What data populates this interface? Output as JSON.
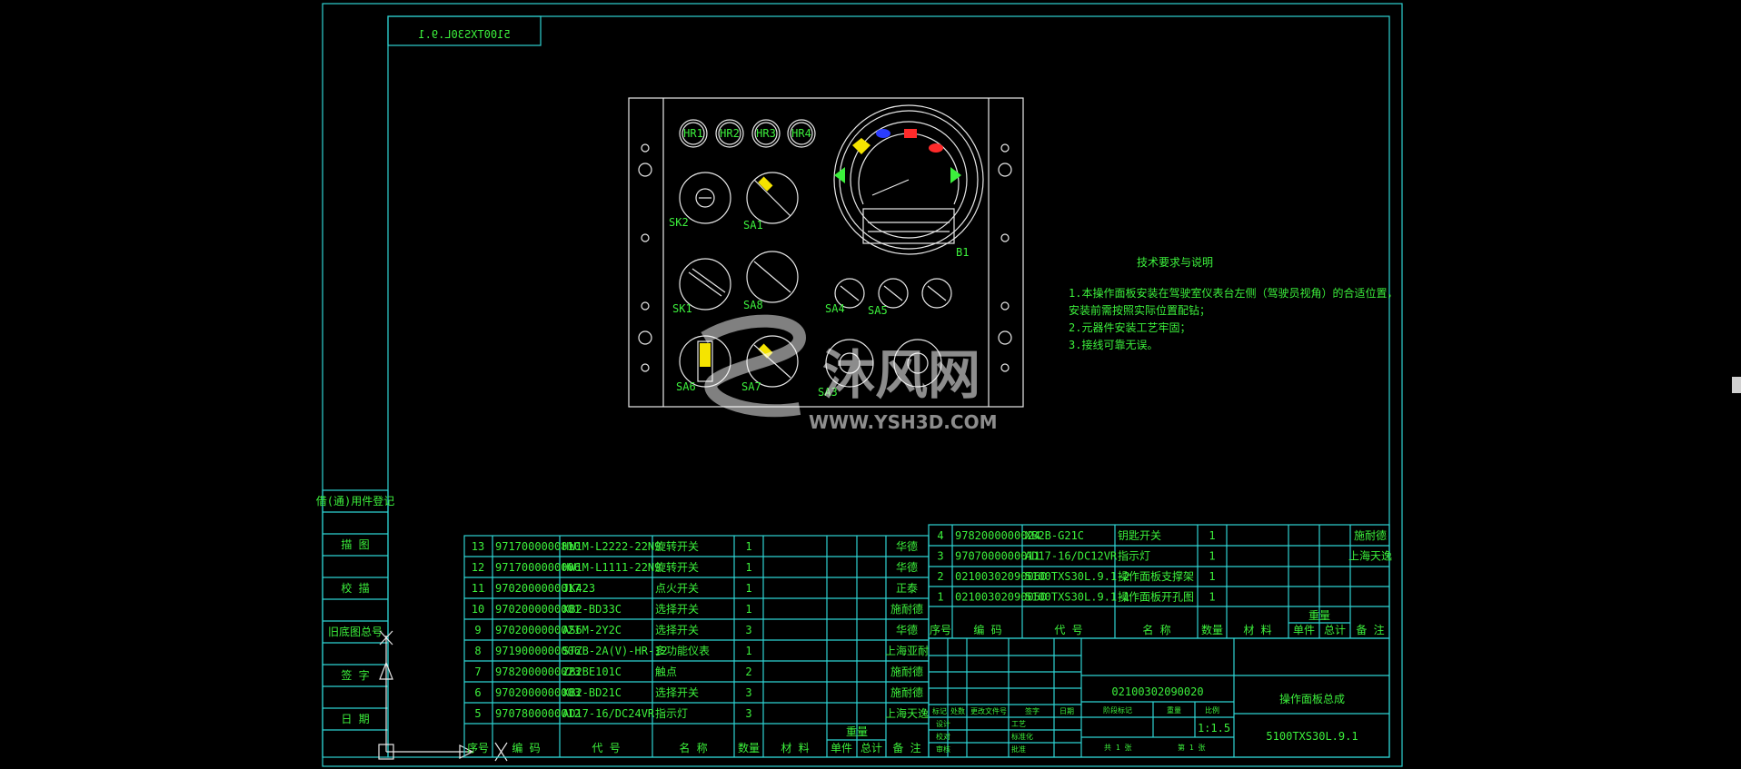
{
  "drawing_code_mirrored": "5100TXS30L.9.1",
  "notes": {
    "title": "技术要求与说明",
    "lines": [
      "1.本操作面板安装在驾驶室仪表台左侧（驾驶员视角）的合适位置，",
      "   安装前需按照实际位置配钻；",
      "2.元器件安装工艺牢固；",
      "3.接线可靠无误。"
    ]
  },
  "panel": {
    "indicators": [
      "HR1",
      "HR2",
      "HR3",
      "HR4"
    ],
    "switches": [
      "SK2",
      "SA1",
      "SK1",
      "SA8",
      "SA4",
      "SA5",
      "B1",
      "SA6",
      "SA7",
      "SA3"
    ]
  },
  "left_stamps": [
    "借(通)用件登记",
    "描 图",
    "校 描",
    "旧底图总号",
    "签 字",
    "日 期"
  ],
  "bom_left": {
    "rows": [
      {
        "no": "13",
        "code": "9717000000810",
        "spec": "HW1M-L2222-22N9",
        "name": "旋转开关",
        "qty": "1",
        "maker": "华德"
      },
      {
        "no": "12",
        "code": "9717000000006",
        "spec": "HW1M-L1111-22N9",
        "name": "旋转开关",
        "qty": "1",
        "maker": "华德"
      },
      {
        "no": "11",
        "code": "9702000000017",
        "spec": "JK423",
        "name": "点火开关",
        "qty": "1",
        "maker": "正泰"
      },
      {
        "no": "10",
        "code": "9702000000001",
        "spec": "XB2-BD33C",
        "name": "选择开关",
        "qty": "1",
        "maker": "施耐德"
      },
      {
        "no": "9",
        "code": "9702000000021",
        "spec": "AS6M-2Y2C",
        "name": "选择开关",
        "qty": "3",
        "maker": "华德"
      },
      {
        "no": "8",
        "code": "9719000000006",
        "spec": "STZB-2A(V)-HR-12",
        "name": "多功能仪表",
        "qty": "1",
        "maker": "上海亚耐"
      },
      {
        "no": "7",
        "code": "9782000000023",
        "spec": "ZB2BE101C",
        "name": "触点",
        "qty": "2",
        "maker": "施耐德"
      },
      {
        "no": "6",
        "code": "9702000000003",
        "spec": "XB2-BD21C",
        "name": "选择开关",
        "qty": "3",
        "maker": "施耐德"
      },
      {
        "no": "5",
        "code": "9707800000012",
        "spec": "AD17-16/DC24VR",
        "name": "指示灯",
        "qty": "3",
        "maker": "上海天逸"
      }
    ],
    "header": [
      "序号",
      "编 码",
      "代 号",
      "名 称",
      "数量",
      "材 料",
      "单件",
      "总计",
      "备 注"
    ],
    "weight_header": "重量"
  },
  "bom_right": {
    "rows": [
      {
        "no": "4",
        "code": "9782000000024",
        "spec": "XB2B-G21C",
        "name": "钥匙开关",
        "qty": "1",
        "maker": "施耐德"
      },
      {
        "no": "3",
        "code": "9707000000011",
        "spec": "AD17-16/DC12VR",
        "name": "指示灯",
        "qty": "1",
        "maker": "上海天逸"
      },
      {
        "no": "2",
        "code": "02100302090060",
        "spec": "5100TXS30L.9.1-2",
        "name": "操作面板支撑架",
        "qty": "1",
        "maker": ""
      },
      {
        "no": "1",
        "code": "02100302090050",
        "spec": "5100TXS30L.9.1-1",
        "name": "操作面板开孔图",
        "qty": "1",
        "maker": ""
      }
    ],
    "header": [
      "序号",
      "编 码",
      "代 号",
      "名 称",
      "数量",
      "材 料",
      "单件",
      "总计",
      "备 注"
    ],
    "weight_header": "重量"
  },
  "title_block": {
    "code": "02100302090020",
    "title": "操作面板总成",
    "drawing_no": "5100TXS30L.9.1",
    "scale": "1:1.5",
    "left_labels": [
      "标记",
      "处数",
      "更改文件号",
      "签字",
      "日期"
    ],
    "role_labels": [
      "设计",
      "校对",
      "审核",
      "工艺",
      "标准化",
      "批准"
    ],
    "stage_labels": [
      "阶段标记",
      "重量",
      "比例"
    ],
    "sheet_labels": [
      "共 1 张",
      "第 1 张"
    ]
  },
  "watermark": {
    "text": "沐风网",
    "url": "WWW.YSH3D.COM"
  },
  "colors": {
    "frame": "#2ed3d3",
    "text": "#3cf03c",
    "linework": "#e8e8e8",
    "background": "#000000",
    "red": "#ff2a2a",
    "blue": "#2a3cff",
    "yellow": "#f5e400"
  }
}
